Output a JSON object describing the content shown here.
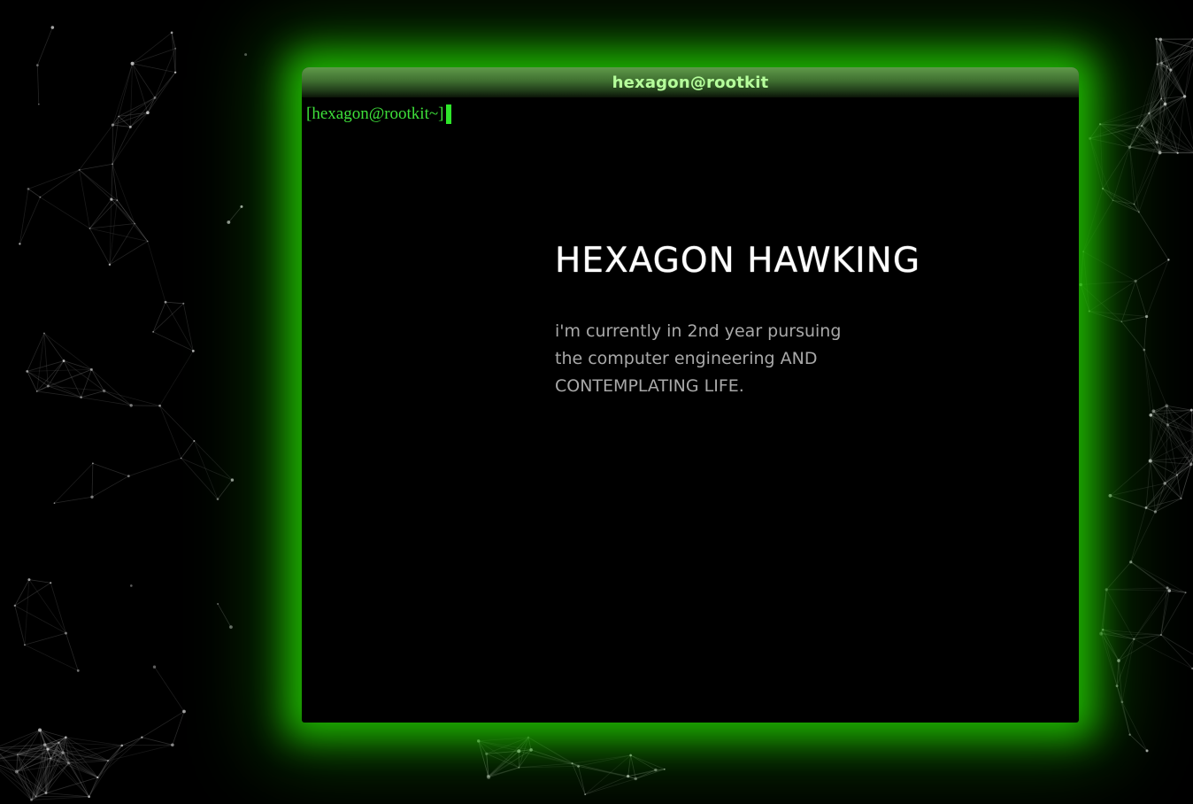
{
  "window": {
    "title": "hexagon@rootkit"
  },
  "terminal": {
    "prompt": "[hexagon@rootkit~]"
  },
  "hero": {
    "name": "HEXAGON HAWKING",
    "description_lines": [
      "i'm currently in 2nd year pursuing",
      "the computer engineering AND",
      "CONTEMPLATING LIFE."
    ]
  },
  "colors": {
    "background": "#000000",
    "glow": "#22c800",
    "title_text": "#b6ff9c",
    "prompt": "#3ee03a",
    "heading": "#ffffff",
    "body_text": "#a8a8a8"
  },
  "icons": {
    "background": "particle-network-background"
  }
}
